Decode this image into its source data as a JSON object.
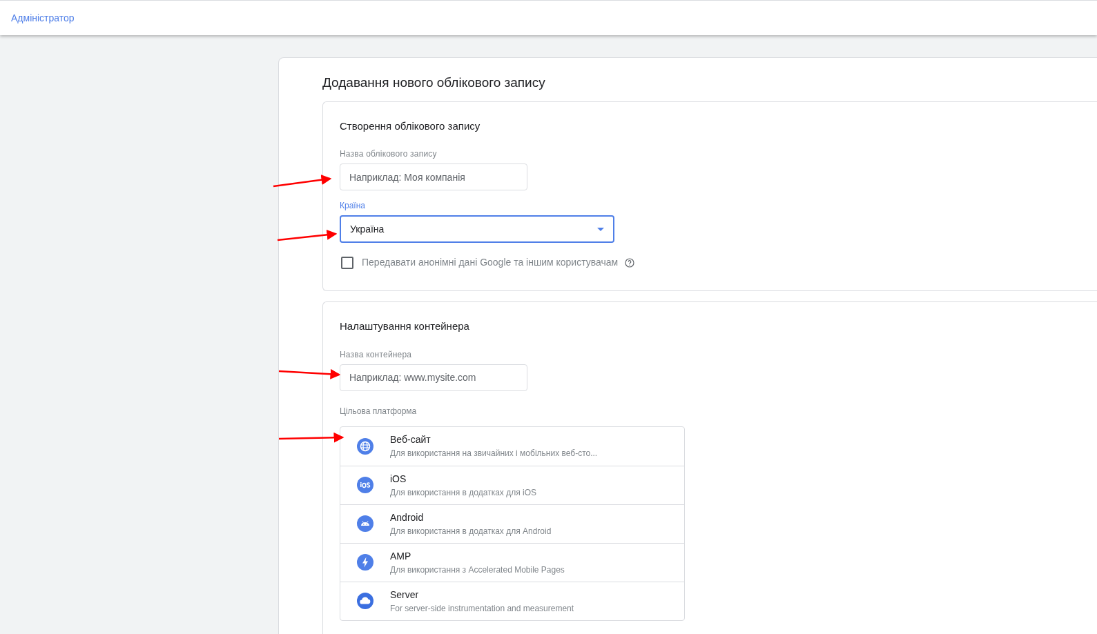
{
  "header": {
    "title": "Адміністратор"
  },
  "page_title": "Додавання нового облікового запису",
  "account_section": {
    "title": "Створення облікового запису",
    "name_field": {
      "label": "Назва облікового запису",
      "placeholder": "Наприклад: Моя компанія"
    },
    "country_field": {
      "label": "Країна",
      "value": "Україна",
      "focused": true
    },
    "share_checkbox": {
      "label": "Передавати анонімні дані Google та іншим користувачам",
      "checked": false
    }
  },
  "container_section": {
    "title": "Налаштування контейнера",
    "name_field": {
      "label": "Назва контейнера",
      "placeholder": "Наприклад: www.mysite.com"
    },
    "platform_label": "Цільова платформа",
    "platforms": [
      {
        "kind": "web",
        "title": "Веб-сайт",
        "description": "Для використання на звичайних і мобільних веб-сто..."
      },
      {
        "kind": "ios",
        "title": "iOS",
        "description": "Для використання в додатках для iOS"
      },
      {
        "kind": "android",
        "title": "Android",
        "description": "Для використання в додатках для Android"
      },
      {
        "kind": "amp",
        "title": "AMP",
        "description": "Для використання з Accelerated Mobile Pages"
      },
      {
        "kind": "server",
        "title": "Server",
        "description": "For server-side instrumentation and measurement"
      }
    ]
  }
}
